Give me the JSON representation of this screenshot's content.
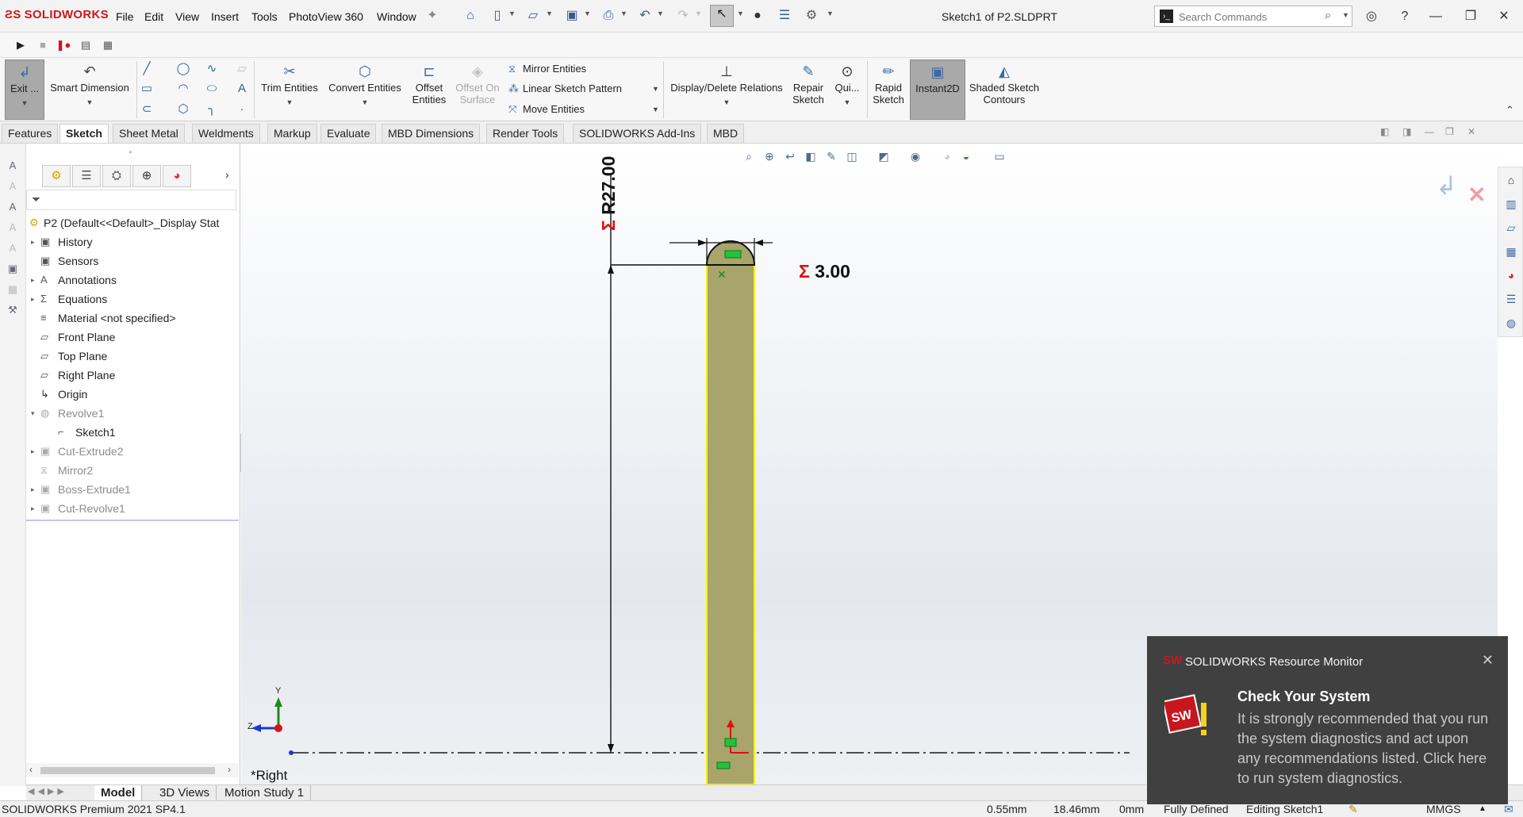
{
  "app": {
    "logo_text": "SOLIDWORKS",
    "document_title": "Sketch1 of P2.SLDPRT"
  },
  "menu": [
    "File",
    "Edit",
    "View",
    "Insert",
    "Tools",
    "PhotoView 360",
    "Window"
  ],
  "search": {
    "placeholder": "Search Commands"
  },
  "command_manager": {
    "exit_sketch": "Exit ...",
    "smart_dimension": "Smart Dimension",
    "trim_entities": "Trim Entities",
    "convert_entities": "Convert Entities",
    "offset_entities_1": "Offset",
    "offset_entities_2": "Entities",
    "offset_on_surface_1": "Offset On",
    "offset_on_surface_2": "Surface",
    "mirror_entities": "Mirror Entities",
    "linear_sketch_pattern": "Linear Sketch Pattern",
    "move_entities": "Move Entities",
    "display_delete_relations": "Display/Delete Relations",
    "repair_sketch_1": "Repair",
    "repair_sketch_2": "Sketch",
    "quick_snaps": "Qui...",
    "rapid_sketch_1": "Rapid",
    "rapid_sketch_2": "Sketch",
    "instant2d": "Instant2D",
    "shaded_sketch_1": "Shaded Sketch",
    "shaded_sketch_2": "Contours"
  },
  "tabs": [
    "Features",
    "Sketch",
    "Sheet Metal",
    "Weldments",
    "Markup",
    "Evaluate",
    "MBD Dimensions",
    "Render Tools",
    "SOLIDWORKS Add-Ins",
    "MBD"
  ],
  "active_tab": "Sketch",
  "feature_tree": {
    "root": "P2  (Default<<Default>_Display Stat",
    "items": [
      {
        "label": "History"
      },
      {
        "label": "Sensors"
      },
      {
        "label": "Annotations"
      },
      {
        "label": "Equations"
      },
      {
        "label": "Material <not specified>"
      },
      {
        "label": "Front Plane"
      },
      {
        "label": "Top Plane"
      },
      {
        "label": "Right Plane"
      },
      {
        "label": "Origin"
      },
      {
        "label": "Revolve1"
      },
      {
        "label": "Sketch1"
      },
      {
        "label": "Cut-Extrude2"
      },
      {
        "label": "Mirror2"
      },
      {
        "label": "Boss-Extrude1"
      },
      {
        "label": "Cut-Revolve1"
      }
    ]
  },
  "graphics": {
    "dim_radius": "R27.00",
    "dim_width": "3.00",
    "view_label": "*Right",
    "axis_x": "Z",
    "axis_y": "Y"
  },
  "bottom_tabs": [
    "Model",
    "3D Views",
    "Motion Study 1"
  ],
  "status": {
    "product": "SOLIDWORKS Premium 2021 SP4.1",
    "x": "0.55mm",
    "y": "18.46mm",
    "z": "0mm",
    "state": "Fully Defined",
    "editing": "Editing Sketch1",
    "units": "MMGS"
  },
  "notification": {
    "title": "SOLIDWORKS Resource Monitor",
    "heading": "Check Your System",
    "body": "It is strongly recommended that you run the system diagnostics and act upon any recommendations listed. Click here to run system diagnostics."
  },
  "colors": {
    "brand_red": "#d1161c",
    "part_fill": "#a8a46a",
    "sketch_highlight": "#f4f21c",
    "notification_bg": "#404040"
  }
}
